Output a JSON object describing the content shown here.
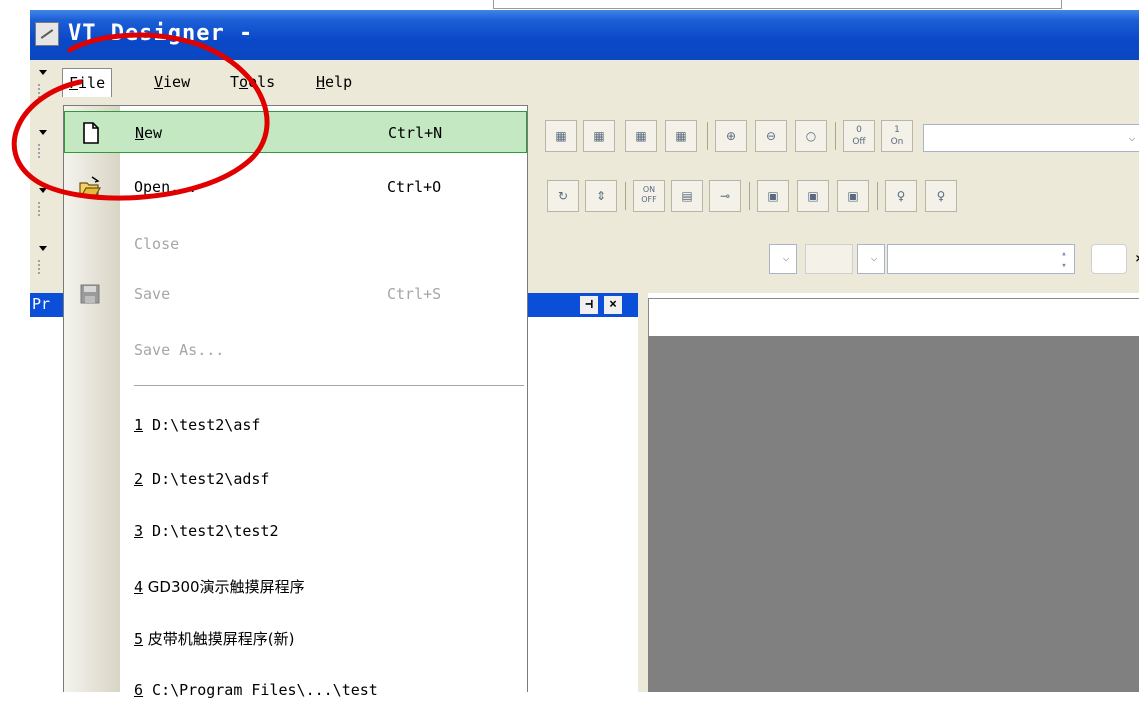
{
  "window": {
    "title": "VT Designer -"
  },
  "menubar": {
    "items": [
      {
        "label": "File",
        "mnemonic": "F"
      },
      {
        "label": "View",
        "mnemonic": "V"
      },
      {
        "label": "Tools",
        "mnemonic": "o"
      },
      {
        "label": "Help",
        "mnemonic": "H"
      }
    ]
  },
  "file_menu": {
    "new_label": "New",
    "new_shortcut": "Ctrl+N",
    "open_label": "Open...",
    "open_shortcut": "Ctrl+O",
    "close_label": "Close",
    "save_label": "Save",
    "save_shortcut": "Ctrl+S",
    "saveas_label": "Save As...",
    "recent": [
      {
        "num": "1",
        "path": " D:\\test2\\asf"
      },
      {
        "num": "2",
        "path": " D:\\test2\\adsf"
      },
      {
        "num": "3",
        "path": " D:\\test2\\test2"
      },
      {
        "num": "4",
        "path": " GD300演示触摸屏程序"
      },
      {
        "num": "5",
        "path": " 皮带机触摸屏程序(新)"
      },
      {
        "num": "6",
        "path": " C:\\Program Files\\...\\test"
      }
    ]
  },
  "panel": {
    "title": "Pr",
    "pin_glyph": "⊣",
    "close_glyph": "×"
  },
  "toolbar": {
    "off_label": "0\nOff",
    "on_label": "1\nOn",
    "more_glyph": "»",
    "on_small": "ON\nOFF"
  },
  "colors": {
    "highlight": "#c4e8c2",
    "annotation": "#e00000",
    "titlebar": "#0a48c8",
    "workspace": "#808080"
  }
}
